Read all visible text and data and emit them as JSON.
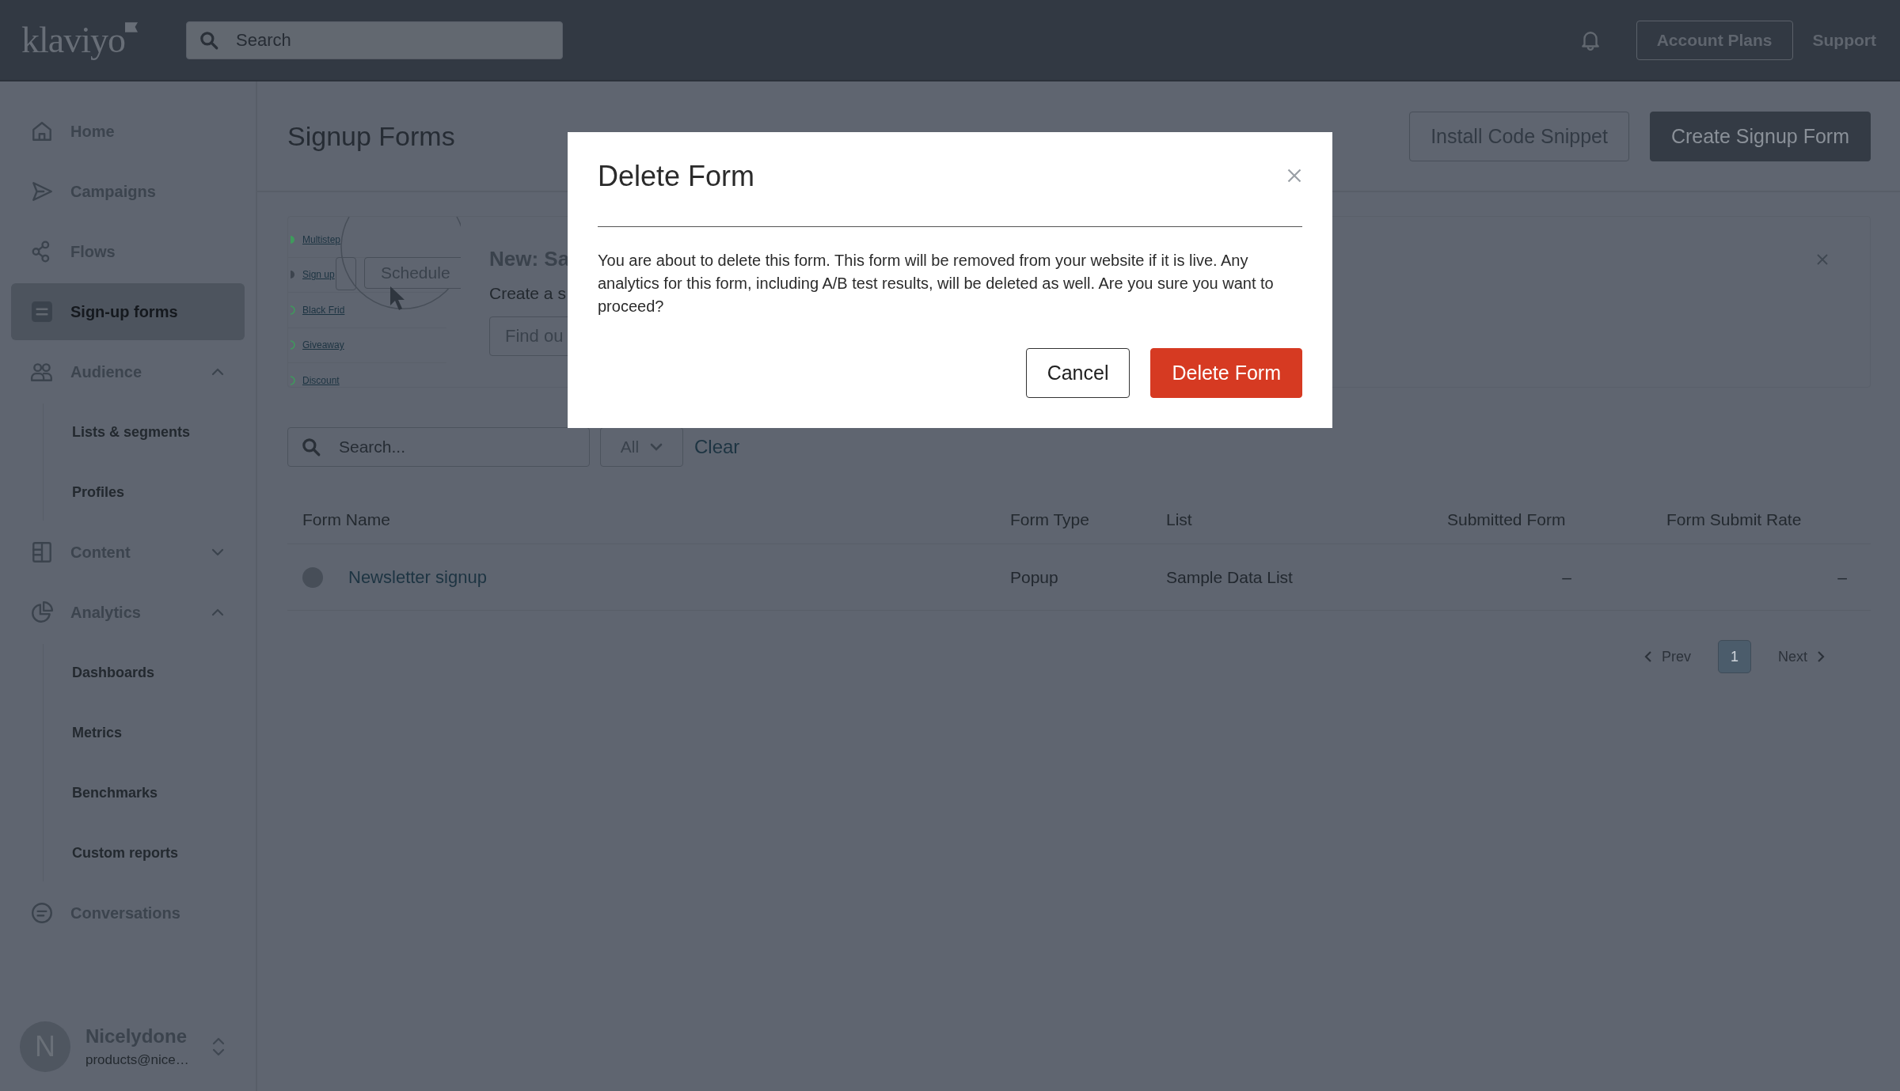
{
  "topbar": {
    "logo": "klaviyo",
    "search": {
      "placeholder": "Search"
    },
    "buttons": [
      {
        "label": "Account Plans",
        "kind": "outline"
      },
      {
        "label": "Support",
        "kind": "link"
      }
    ]
  },
  "sidebar": {
    "items": [
      {
        "label": "Home",
        "selected": false
      },
      {
        "label": "Campaigns",
        "selected": false
      },
      {
        "label": "Flows",
        "selected": false
      },
      {
        "label": "Sign-up forms",
        "selected": true
      },
      {
        "label": "Audience",
        "selected": false,
        "expanded": true,
        "children": [
          {
            "label": "Lists & segments",
            "selected": false
          },
          {
            "label": "Profiles",
            "selected": false
          }
        ]
      },
      {
        "label": "Content",
        "selected": false,
        "expanded": false
      },
      {
        "label": "Analytics",
        "selected": false,
        "expanded": true,
        "children": [
          {
            "label": "Dashboards",
            "selected": false
          },
          {
            "label": "Metrics",
            "selected": false
          },
          {
            "label": "Benchmarks",
            "selected": false
          },
          {
            "label": "Custom reports",
            "selected": false
          }
        ]
      },
      {
        "label": "Conversations",
        "selected": false
      }
    ],
    "user": {
      "initial": "N",
      "name": "Nicelydone",
      "email": "products@nice…"
    }
  },
  "header": {
    "title": "Signup Forms",
    "buttons": [
      {
        "label": "Install Code Snippet",
        "kind": "outline"
      },
      {
        "label": "Create Signup Form",
        "kind": "primary"
      }
    ]
  },
  "banner": {
    "illustration": {
      "list_items": [
        {
          "label": "Multistep",
          "kind": "filled",
          "color": "#3f9a5c"
        },
        {
          "label": "Sign up",
          "kind": "filled",
          "color": "#3d444e"
        },
        {
          "label": "Black Frid",
          "kind": "outline",
          "color": "#3f9a5c"
        },
        {
          "label": "Giveaway",
          "kind": "outline",
          "color": "#3f9a5c"
        },
        {
          "label": "Discount",
          "kind": "outline",
          "color": "#3f9a5c"
        }
      ],
      "button": "Schedule"
    },
    "title": "New: Sa",
    "text": "Create a s",
    "button": "Find ou"
  },
  "filters": {
    "search": {
      "placeholder": "Search..."
    },
    "dropdown": {
      "value": "All"
    },
    "clear": "Clear"
  },
  "table": {
    "columns": [
      "Form Name",
      "Form Type",
      "List",
      "Submitted Form",
      "Form Submit Rate"
    ],
    "rows": [
      {
        "cells": [
          "Newsletter signup",
          "Popup",
          "Sample Data List",
          "–",
          "–"
        ]
      }
    ]
  },
  "pagination": {
    "prev": {
      "label": "Prev",
      "disabled": true
    },
    "pages": [
      {
        "label": "1",
        "selected": true
      }
    ],
    "next": {
      "label": "Next",
      "disabled": true
    }
  },
  "modal": {
    "title": "Delete Form",
    "body": "You are about to delete this form. This form will be removed from your website if it is live. Any analytics for this form, including A/B test results, will be deleted as well. Are you sure you want to proceed?",
    "buttons": [
      {
        "label": "Cancel",
        "kind": "secondary"
      },
      {
        "label": "Delete Form",
        "kind": "danger"
      }
    ]
  }
}
